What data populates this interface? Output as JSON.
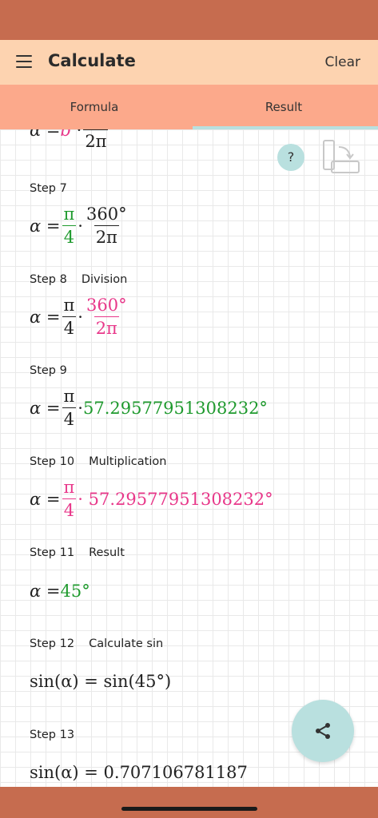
{
  "appbar": {
    "title": "Calculate",
    "clear_label": "Clear",
    "menu_icon": "hamburger-menu-icon"
  },
  "tabs": [
    {
      "label": "Formula",
      "active": false
    },
    {
      "label": "Result",
      "active": true
    }
  ],
  "help_button": {
    "label": "?"
  },
  "colors": {
    "status_bar": "#c66c4f",
    "app_bar": "#fdd3b0",
    "tab_bar": "#fca98b",
    "accent": "#b9e0df",
    "green": "#1f9a2e",
    "pink": "#e8388a"
  },
  "steps": [
    {
      "label": "",
      "description": "",
      "expr": {
        "lhs": "α",
        "eq": "=",
        "b": "b",
        "dot": "·",
        "den": "2π"
      }
    },
    {
      "label": "Step 7",
      "description": "",
      "expr": {
        "lhs": "α",
        "eq": "=",
        "f1_num": "π",
        "f1_den": "4",
        "dot": "·",
        "f2_num": "360°",
        "f2_den": "2π"
      }
    },
    {
      "label": "Step 8",
      "description": "Division",
      "expr": {
        "lhs": "α",
        "eq": "=",
        "f1_num": "π",
        "f1_den": "4",
        "dot": "·",
        "f2_num": "360°",
        "f2_den": "2π"
      }
    },
    {
      "label": "Step 9",
      "description": "",
      "expr": {
        "lhs": "α",
        "eq": "=",
        "f1_num": "π",
        "f1_den": "4",
        "dot": "·",
        "value": "57.29577951308232°"
      }
    },
    {
      "label": "Step 10",
      "description": "Multiplication",
      "expr": {
        "lhs": "α",
        "eq": "=",
        "f1_num": "π",
        "f1_den": "4",
        "dot": "·",
        "value": "57.29577951308232°"
      }
    },
    {
      "label": "Step 11",
      "description": "Result",
      "expr": {
        "lhs": "α",
        "eq": "=",
        "value": "45°"
      }
    },
    {
      "label": "Step 12",
      "description": "Calculate sin",
      "expr": {
        "text": "sin(α) = sin(45°)"
      }
    },
    {
      "label": "Step 13",
      "description": "",
      "expr": {
        "text": "sin(α) = 0.707106781187"
      }
    }
  ],
  "share_icon": "share-icon",
  "rotate_icon": "rotate-screen-icon"
}
